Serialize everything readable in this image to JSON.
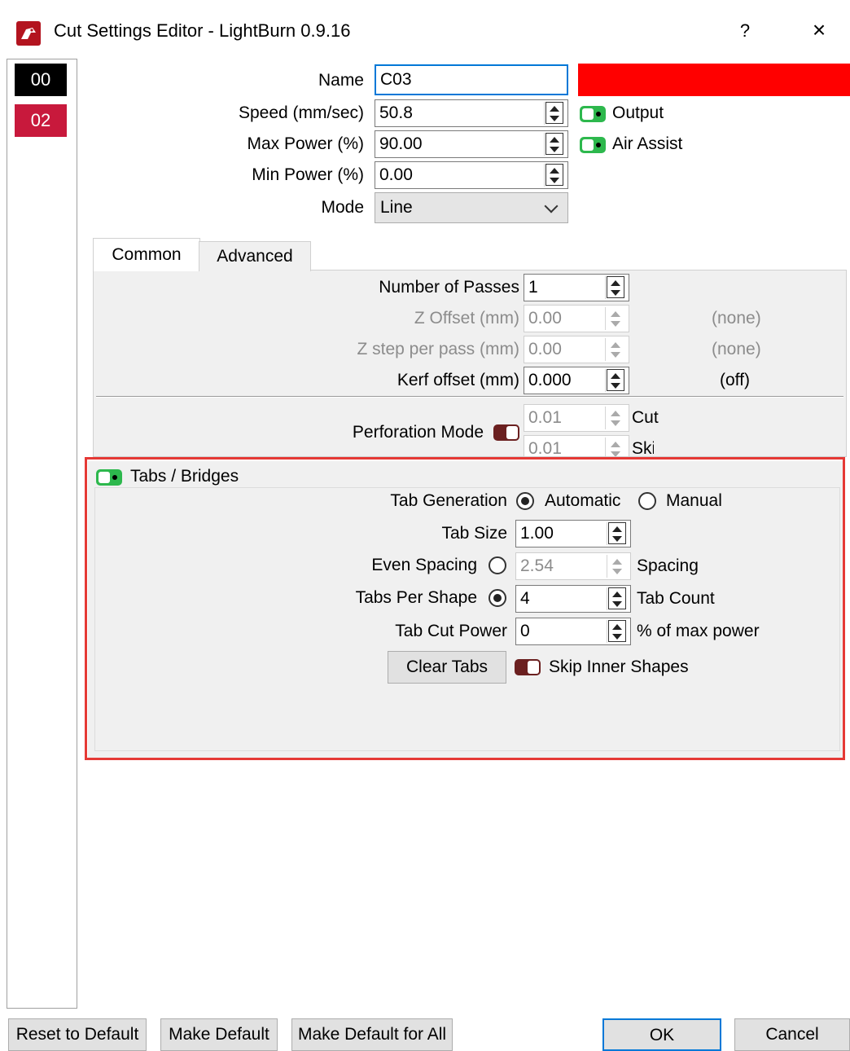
{
  "window": {
    "title": "Cut Settings Editor - LightBurn 0.9.16",
    "help": "?",
    "close": "×"
  },
  "layers": [
    {
      "label": "00",
      "color": "#000000"
    },
    {
      "label": "02",
      "color": "#c8193c"
    }
  ],
  "settings": {
    "name": {
      "label": "Name",
      "value": "C03"
    },
    "speed": {
      "label": "Speed (mm/sec)",
      "value": "50.8"
    },
    "max_power": {
      "label": "Max Power (%)",
      "value": "90.00"
    },
    "min_power": {
      "label": "Min Power (%)",
      "value": "0.00"
    },
    "mode": {
      "label": "Mode",
      "value": "Line"
    },
    "layer_color": "#ff0000",
    "output": {
      "label": "Output",
      "on": true
    },
    "air_assist": {
      "label": "Air Assist",
      "on": true
    }
  },
  "tabs": [
    {
      "label": "Common"
    },
    {
      "label": "Advanced"
    }
  ],
  "common": {
    "passes": {
      "label": "Number of Passes",
      "value": "1"
    },
    "z_offset": {
      "label": "Z Offset (mm)",
      "value": "0.00",
      "note": "(none)"
    },
    "z_step": {
      "label": "Z step per pass (mm)",
      "value": "0.00",
      "note": "(none)"
    },
    "kerf": {
      "label": "Kerf offset (mm)",
      "value": "0.000",
      "note": "(off)"
    },
    "perforation": {
      "label": "Perforation Mode",
      "on": false,
      "cut_value": "0.01",
      "cut_label": "Cut",
      "skip_value": "0.01",
      "skip_label": "Skip"
    }
  },
  "tabs_bridges": {
    "title": "Tabs / Bridges",
    "enabled": true,
    "generation": {
      "label": "Tab Generation",
      "options": [
        "Automatic",
        "Manual"
      ],
      "selected": "Automatic"
    },
    "tab_size": {
      "label": "Tab Size",
      "value": "1.00"
    },
    "even_spacing": {
      "label": "Even Spacing",
      "value": "2.54",
      "suffix": "Spacing",
      "selected": false
    },
    "tabs_per_shape": {
      "label": "Tabs Per Shape",
      "value": "4",
      "suffix": "Tab Count",
      "selected": true
    },
    "tab_cut_power": {
      "label": "Tab Cut Power",
      "value": "0",
      "suffix": "% of max power"
    },
    "clear_tabs": "Clear Tabs",
    "skip_inner": {
      "label": "Skip Inner Shapes",
      "on": false
    }
  },
  "footer": {
    "reset": "Reset to Default",
    "make_default": "Make Default",
    "make_default_all": "Make Default for All",
    "ok": "OK",
    "cancel": "Cancel"
  }
}
